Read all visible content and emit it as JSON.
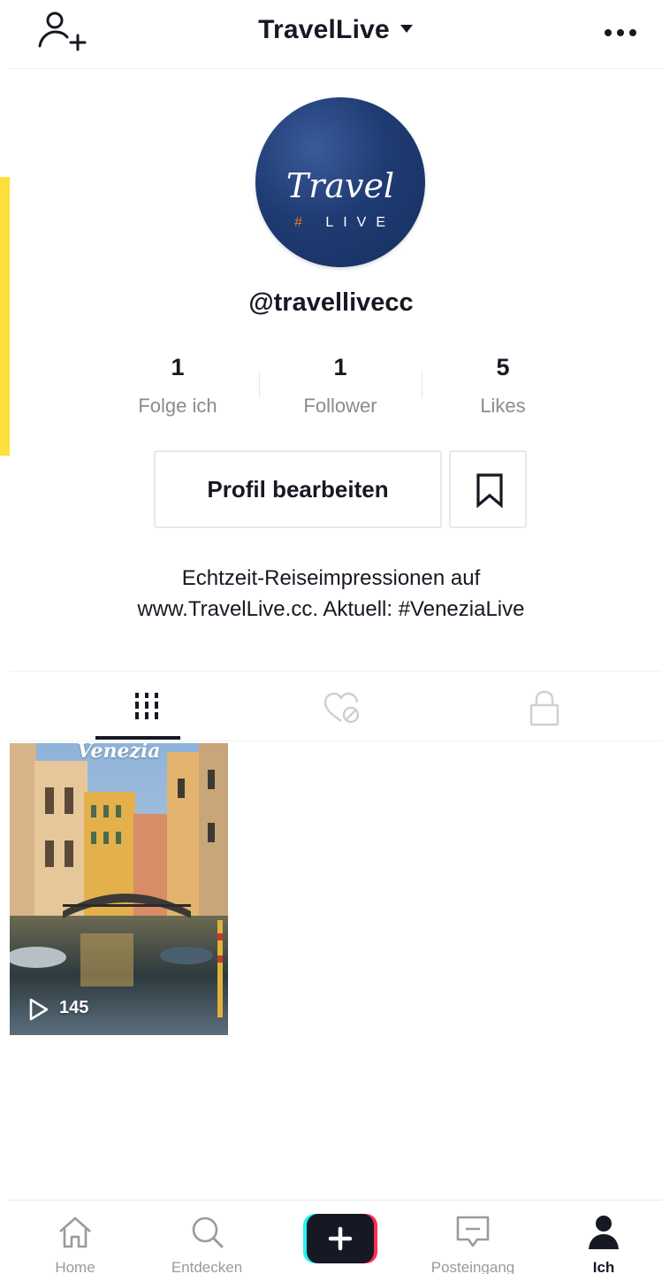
{
  "header": {
    "title": "TravelLive"
  },
  "profile": {
    "avatar_script": "Travel",
    "avatar_hash": "#",
    "avatar_live": "LIVE",
    "handle": "@travellivecc",
    "stats": [
      {
        "value": "1",
        "label": "Folge ich"
      },
      {
        "value": "1",
        "label": "Follower"
      },
      {
        "value": "5",
        "label": "Likes"
      }
    ],
    "edit_label": "Profil bearbeiten",
    "bio_line1": "Echtzeit-Reiseimpressionen auf",
    "bio_line2": "www.TravelLive.cc. Aktuell: #VeneziaLive"
  },
  "tabs": [
    {
      "icon": "grid-icon",
      "active": true
    },
    {
      "icon": "liked-hidden-icon",
      "active": false
    },
    {
      "icon": "lock-icon",
      "active": false
    }
  ],
  "videos": [
    {
      "title": "Venezia",
      "views": "145"
    }
  ],
  "nav": {
    "items": [
      {
        "label": "Home",
        "icon": "home-icon"
      },
      {
        "label": "Entdecken",
        "icon": "search-icon"
      },
      {
        "label": "Posteingang",
        "icon": "inbox-icon"
      },
      {
        "label": "Ich",
        "icon": "profile-icon",
        "active": true
      }
    ]
  },
  "colors": {
    "accent_cyan": "#25f4ee",
    "accent_pink": "#fe2c55",
    "avatar_blue": "#1f3b72",
    "highlight_yellow": "#fde03b"
  }
}
